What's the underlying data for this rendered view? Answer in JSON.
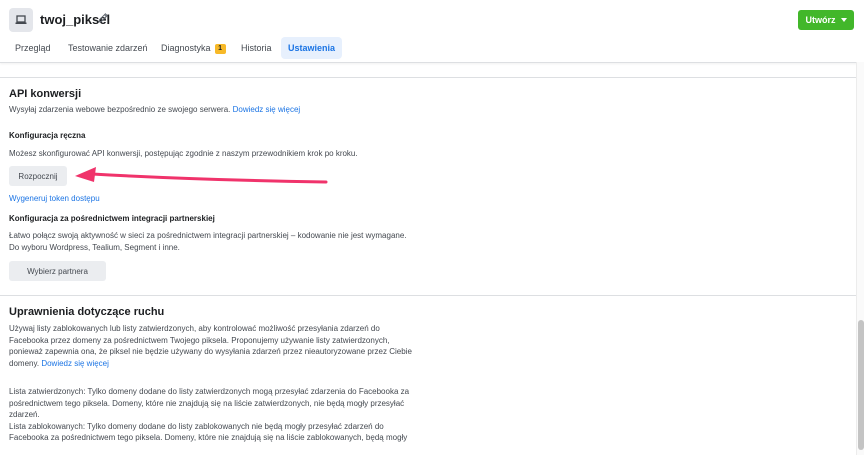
{
  "header": {
    "title": "twoj_piksel",
    "create_label": "Utwórz",
    "tabs": [
      {
        "label": "Przegląd"
      },
      {
        "label": "Testowanie zdarzeń"
      },
      {
        "label": "Diagnostyka",
        "badge": "1"
      },
      {
        "label": "Historia"
      },
      {
        "label": "Ustawienia",
        "active": true
      }
    ]
  },
  "api": {
    "title": "API konwersji",
    "description": "Wysyłaj zdarzenia webowe bezpośrednio ze swojego serwera.",
    "learn_more": "Dowiedz się więcej",
    "manual": {
      "title": "Konfiguracja ręczna",
      "description": "Możesz skonfigurować API konwersji, postępując zgodnie z naszym przewodnikiem krok po kroku.",
      "button": "Rozpocznij",
      "token_link": "Wygeneruj token dostępu"
    },
    "partner": {
      "title": "Konfiguracja za pośrednictwem integracji partnerskiej",
      "description_line1": "Łatwo połącz swoją aktywność w sieci za pośrednictwem integracji partnerskiej – kodowanie nie jest wymagane.",
      "description_line2": "Do wyboru Wordpress, Tealium, Segment i inne.",
      "button": "Wybierz partnera"
    }
  },
  "traffic": {
    "title": "Uprawnienia dotyczące ruchu",
    "line1": "Używaj listy zablokowanych lub listy zatwierdzonych, aby kontrolować możliwość przesyłania zdarzeń do",
    "line2": "Facebooka przez domeny za pośrednictwem Twojego piksela. Proponujemy używanie listy zatwierdzonych,",
    "line3": "ponieważ zapewnia ona, że piksel nie będzie używany do wysyłania zdarzeń przez nieautoryzowane przez Ciebie",
    "line4": "domeny.",
    "learn_more": "Dowiedz się więcej",
    "approved_line1": "Lista zatwierdzonych: Tylko domeny dodane do listy zatwierdzonych mogą przesyłać zdarzenia do Facebooka za",
    "approved_line2": "pośrednictwem tego piksela. Domeny, które nie znajdują się na liście zatwierdzonych, nie będą mogły przesyłać",
    "approved_line3": "zdarzeń.",
    "blocked_line1": "Lista zablokowanych: Tylko domeny dodane do listy zablokowanych nie będą mogły przesyłać zdarzeń do",
    "blocked_line2": "Facebooka za pośrednictwem tego piksela. Domeny, które nie znajdują się na liście zablokowanych, będą mogły"
  },
  "colors": {
    "accent": "#1b74e4",
    "create_button": "#42b72a",
    "arrow": "#f0336b"
  }
}
